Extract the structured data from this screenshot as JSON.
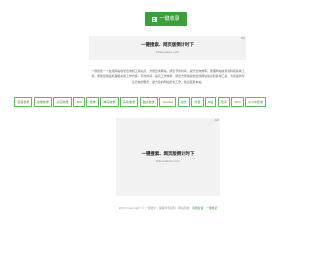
{
  "header": {
    "button_label": "一键收录"
  },
  "ad_top": {
    "title": "一键搜索、网页版倒计时下",
    "sub": "Kitsunalize.com",
    "mark": "AD"
  },
  "description": "一键搜索一个在线网站收录查询和工具站点，方便查询网站，帮您节省时间，提升查询效率，整理网站收录资料和各种工具，帮助您快速处理相关的工作内容，节约时间，提高工作效率，帮您方便快捷地查找网站信息和使用工具，为您提供专业高效的服务，助力您的网站优化工作，欢迎使用本站。",
  "tags": [
    "百度收录",
    "谷歌收录",
    "必应收录",
    "360",
    "搜狗",
    "神马收录",
    "头条收录",
    "雅虎收录",
    "Yandex",
    "站长",
    "抖音",
    "B站",
    "知乎",
    "SEO",
    "ip138查询"
  ],
  "ad_mid": {
    "title": "一键搜索、网页版倒计时下",
    "sub": "Kitsunalize.com",
    "mark": "AD"
  },
  "footer": {
    "text": "2024 Copyright © 一键收录 · 保留所有权利 · 网站导航 ·",
    "link1": "问题反馈",
    "sep": " · ",
    "link2": "一键收录"
  }
}
